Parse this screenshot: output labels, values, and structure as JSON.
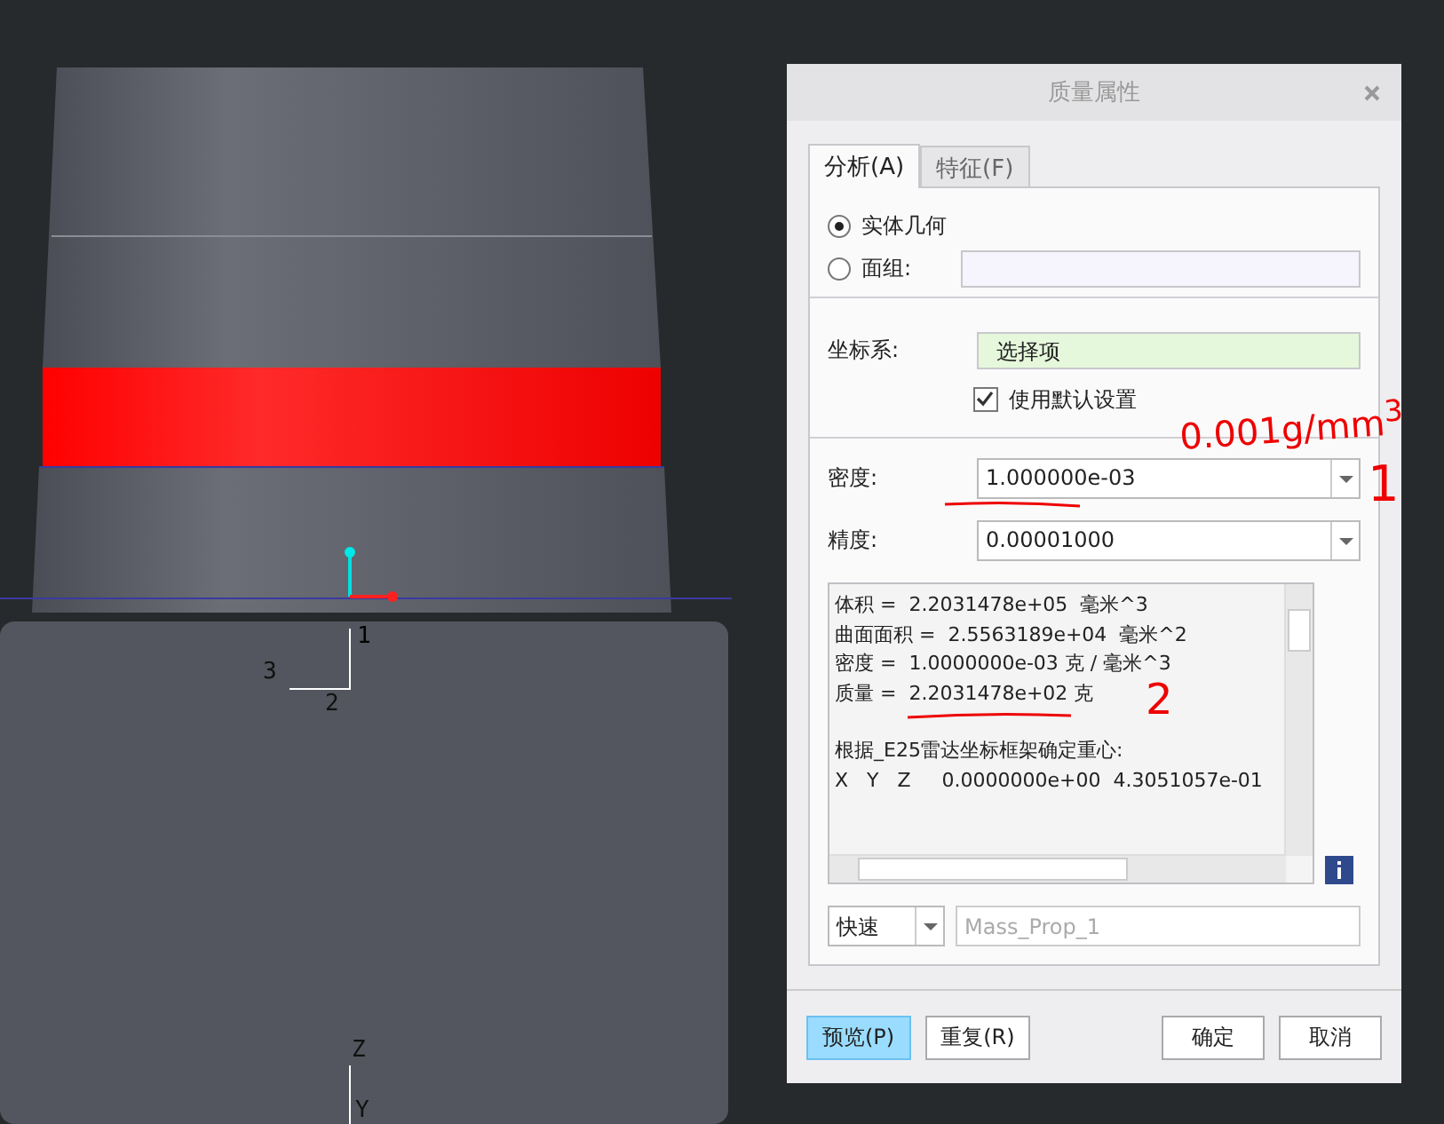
{
  "viewport": {
    "triad_labels": [
      "1",
      "2",
      "3"
    ],
    "axis_labels": [
      "Z",
      "Y"
    ]
  },
  "dialog": {
    "title": "质量属性",
    "tabs": [
      {
        "label": "分析(A)",
        "selected": true
      },
      {
        "label": "特征(F)",
        "selected": false
      }
    ],
    "geometry_options": [
      {
        "label": "实体几何",
        "selected": true
      },
      {
        "label": "面组:",
        "selected": false
      }
    ],
    "coord_system": {
      "label": "坐标系:",
      "value": "选择项"
    },
    "use_default": {
      "label": "使用默认设置",
      "checked": true
    },
    "density": {
      "label": "密度:",
      "value": "1.000000e-03"
    },
    "accuracy": {
      "label": "精度:",
      "value": "0.00001000"
    },
    "results": [
      [
        "体积 =  2.2031478e+05  毫米^3",
        "曲面面积 =  2.5563189e+04  毫米^2",
        "密度 =  1.0000000e-03 克 / 毫米^3",
        "质量 =  2.2031478e+02 克"
      ],
      [
        "根据_E25雷达坐标框架确定重心:",
        "X   Y   Z     0.0000000e+00  4.3051057e-01"
      ]
    ],
    "mode": {
      "value": "快速"
    },
    "name_field": {
      "placeholder": "Mass_Prop_1"
    },
    "buttons": [
      {
        "label": "预览(P)",
        "highlighted": true
      },
      {
        "label": "重复(R)",
        "highlighted": false
      },
      {
        "label": "确定",
        "highlighted": false
      },
      {
        "label": "取消",
        "highlighted": false
      }
    ]
  },
  "annotations": [
    {
      "text": "0.001g/mm$^{3}$"
    },
    {
      "text": "1"
    },
    {
      "text": "2"
    }
  ]
}
